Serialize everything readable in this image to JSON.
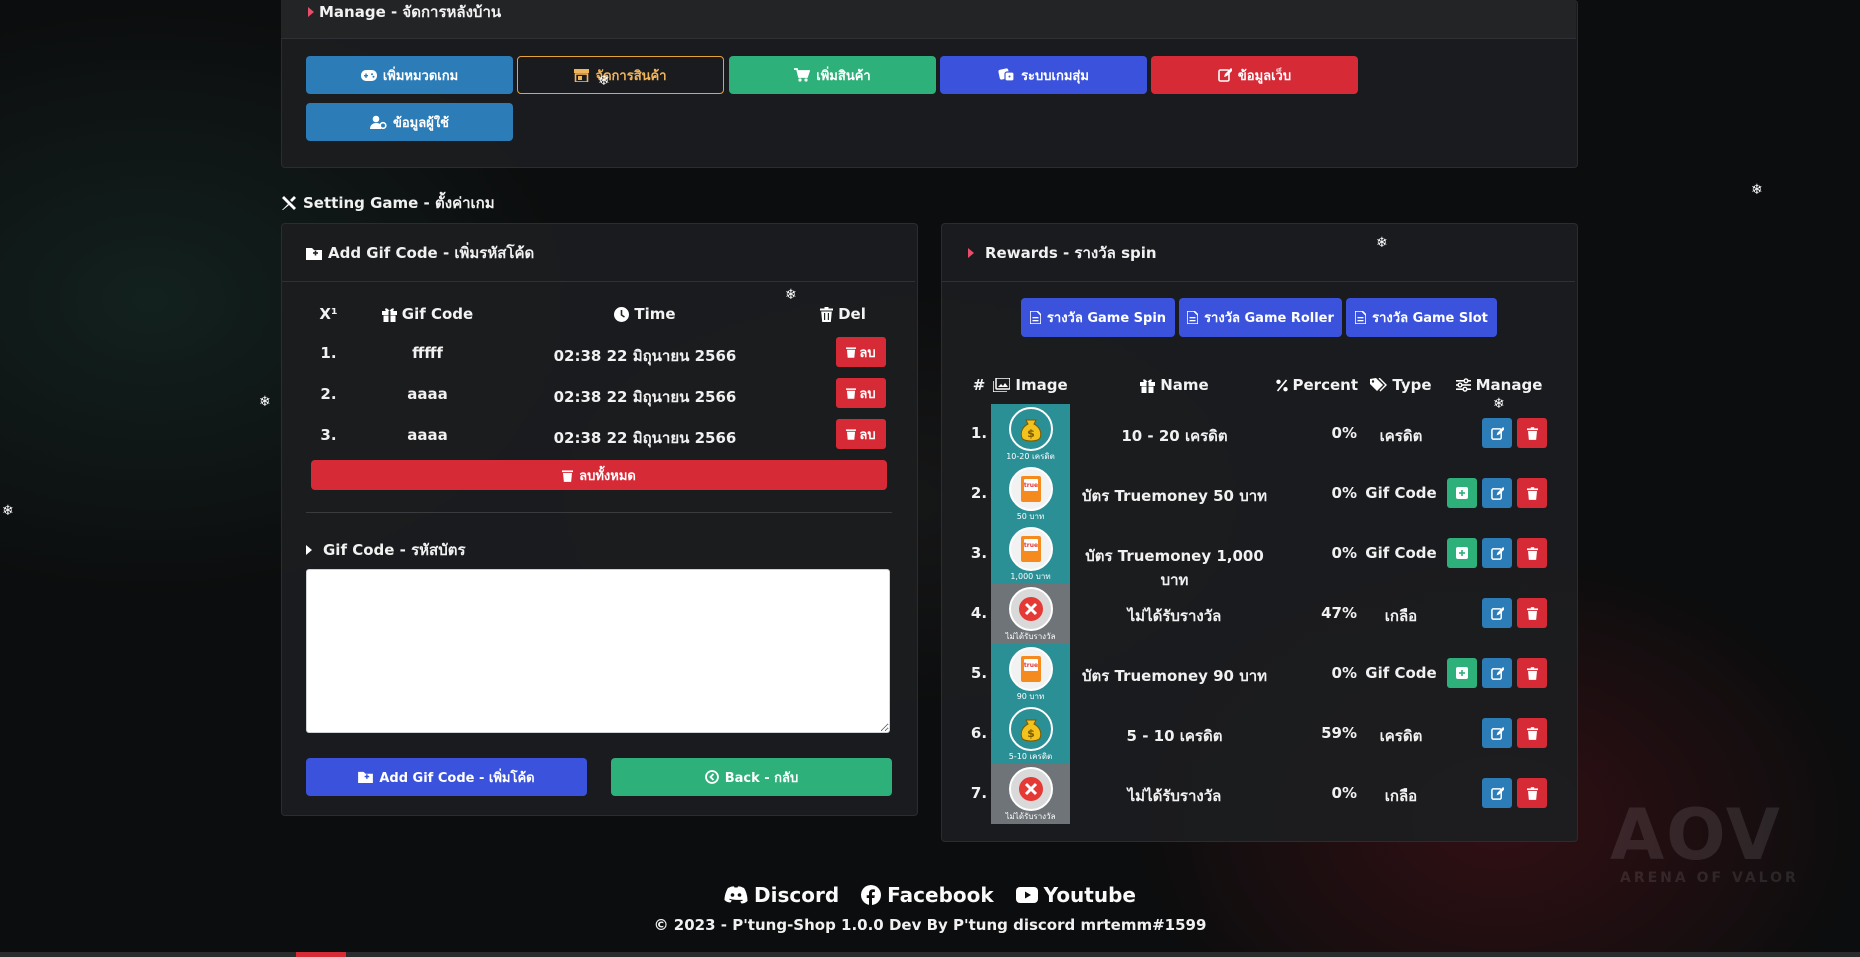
{
  "manage": {
    "title": "Manage - จัดการหลังบ้าน",
    "buttons": [
      {
        "label": "เพิ่มหมวดเกม",
        "icon": "gamepad-icon",
        "color": "#2c7cb8"
      },
      {
        "label": "จัดการสินค้า",
        "icon": "store-icon",
        "color": "#e6a33a"
      },
      {
        "label": "เพิ่มสินค้า",
        "icon": "cart-icon",
        "color": "#2eb07a"
      },
      {
        "label": "ระบบเกมสุ่ม",
        "icon": "dice-icon",
        "color": "#3b53dc"
      },
      {
        "label": "ข้อมูลเว็บ",
        "icon": "edit-icon",
        "color": "#d62a36"
      },
      {
        "label": "ข้อมูลผู้ใช้",
        "icon": "user-gear-icon",
        "color": "#2c7cb8"
      }
    ]
  },
  "setting": {
    "title": "Setting Game - ตั้งค่าเกม"
  },
  "gifcode": {
    "title": "Add Gif Code - เพิ่มรหัสโค้ด",
    "headers": {
      "num": "X¹",
      "code": "Gif Code",
      "time": "Time",
      "del": "Del"
    },
    "rows": [
      {
        "num": "1.",
        "code": "fffff",
        "time": "02:38 22 มิถุนายน 2566",
        "del": "ลบ"
      },
      {
        "num": "2.",
        "code": "aaaa",
        "time": "02:38 22 มิถุนายน 2566",
        "del": "ลบ"
      },
      {
        "num": "3.",
        "code": "aaaa",
        "time": "02:38 22 มิถุนายน 2566",
        "del": "ลบ"
      }
    ],
    "delete_all": "ลบทั้งหมด",
    "input_label": "Gif Code - รหัสบัตร",
    "textarea_value": "",
    "add_button": "Add Gif Code - เพิ่มโค้ด",
    "back_button": "Back - กลับ"
  },
  "rewards": {
    "title": "Rewards - รางวัล spin",
    "tabs": [
      "รางวัล Game Spin",
      "รางวัล Game Roller",
      "รางวัล Game Slot"
    ],
    "headers": {
      "num": "#",
      "image": "Image",
      "name": "Name",
      "percent": "Percent",
      "type": "Type",
      "manage": "Manage"
    },
    "rows": [
      {
        "num": "1.",
        "img_caption": "10-20 เครดิต",
        "img_kind": "coin",
        "name": "10 - 20 เครดิต",
        "percent": "0%",
        "type": "เครดิต",
        "has_add": false
      },
      {
        "num": "2.",
        "img_caption": "50 บาท",
        "img_kind": "true",
        "name": "บัตร Truemoney 50 บาท",
        "percent": "0%",
        "type": "Gif Code",
        "has_add": true
      },
      {
        "num": "3.",
        "img_caption": "1,000 บาท",
        "img_kind": "true",
        "name": "บัตร Truemoney 1,000 บาท",
        "percent": "0%",
        "type": "Gif Code",
        "has_add": true
      },
      {
        "num": "4.",
        "img_caption": "ไม่ได้รับรางวัล",
        "img_kind": "none",
        "name": "ไม่ได้รับรางวัล",
        "percent": "47%",
        "type": "เกลือ",
        "has_add": false
      },
      {
        "num": "5.",
        "img_caption": "90 บาท",
        "img_kind": "true",
        "name": "บัตร Truemoney 90 บาท",
        "percent": "0%",
        "type": "Gif Code",
        "has_add": true
      },
      {
        "num": "6.",
        "img_caption": "5-10 เครดิต",
        "img_kind": "coin",
        "name": "5 - 10 เครดิต",
        "percent": "59%",
        "type": "เครดิต",
        "has_add": false
      },
      {
        "num": "7.",
        "img_caption": "ไม่ได้รับรางวัล",
        "img_kind": "none",
        "name": "ไม่ได้รับรางวัล",
        "percent": "0%",
        "type": "เกลือ",
        "has_add": false
      }
    ]
  },
  "footer": {
    "links": [
      {
        "label": "Discord",
        "icon": "discord-icon"
      },
      {
        "label": "Facebook",
        "icon": "facebook-icon"
      },
      {
        "label": "Youtube",
        "icon": "youtube-icon"
      }
    ],
    "copyright": "© 2023 - P'tung-Shop 1.0.0 Dev By P'tung discord mrtemm#1599"
  },
  "watermark": {
    "big": "AOV",
    "small": "ARENA OF VALOR"
  },
  "colors": {
    "teal": "#2c7cb8",
    "green": "#2eb07a",
    "blue": "#3b53dc",
    "red": "#d62a36",
    "orange": "#e6a33a",
    "img_bg": "#2b8f96"
  }
}
